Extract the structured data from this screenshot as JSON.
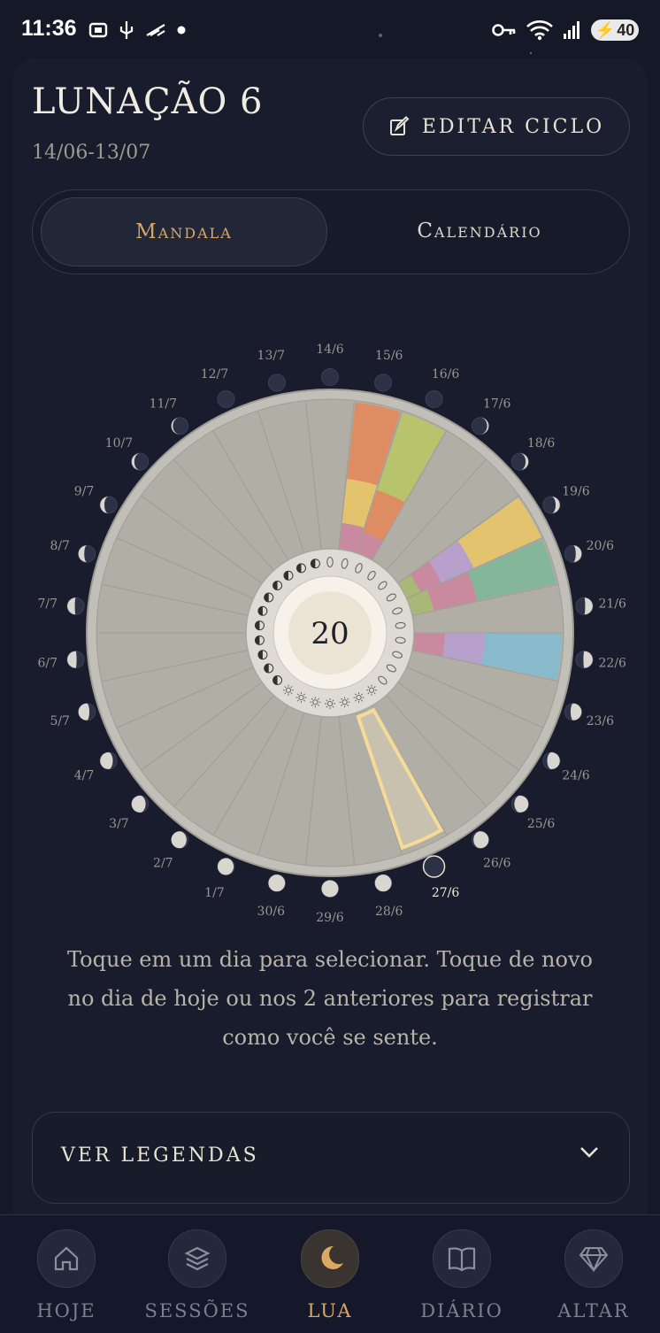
{
  "status": {
    "time": "11:36",
    "battery": "40"
  },
  "header": {
    "title": "LUNAÇÃO 6",
    "date_range": "14/06-13/07",
    "edit_button": "EDITAR CICLO"
  },
  "tabs": {
    "mandala": "Mandala",
    "calendar": "Calendário",
    "active": "mandala"
  },
  "mandala": {
    "center_day": "20",
    "selected_day_label": "27/6",
    "days": [
      "14/6",
      "15/6",
      "16/6",
      "17/6",
      "18/6",
      "19/6",
      "20/6",
      "21/6",
      "22/6",
      "23/6",
      "24/6",
      "25/6",
      "26/6",
      "27/6",
      "28/6",
      "29/6",
      "30/6",
      "1/7",
      "2/7",
      "3/7",
      "4/7",
      "5/7",
      "6/7",
      "7/7",
      "8/7",
      "9/7",
      "10/7",
      "11/7",
      "12/7",
      "13/7"
    ]
  },
  "hint_text": "Toque em um dia para selecionar. Toque de novo no dia de hoje ou nos 2 anteriores para registrar como você se sente.",
  "legend": {
    "label": "VER LEGENDAS"
  },
  "bottom_nav": [
    {
      "label": "HOJE",
      "icon": "home-icon",
      "active": false
    },
    {
      "label": "SESSÕES",
      "icon": "layers-icon",
      "active": false
    },
    {
      "label": "LUA",
      "icon": "moon-icon",
      "active": true
    },
    {
      "label": "DIÁRIO",
      "icon": "book-icon",
      "active": false
    },
    {
      "label": "ALTAR",
      "icon": "diamond-icon",
      "active": false
    }
  ],
  "colors": {
    "accent": "#d9a865",
    "background": "#151827",
    "wheel": "#b1aea6"
  }
}
